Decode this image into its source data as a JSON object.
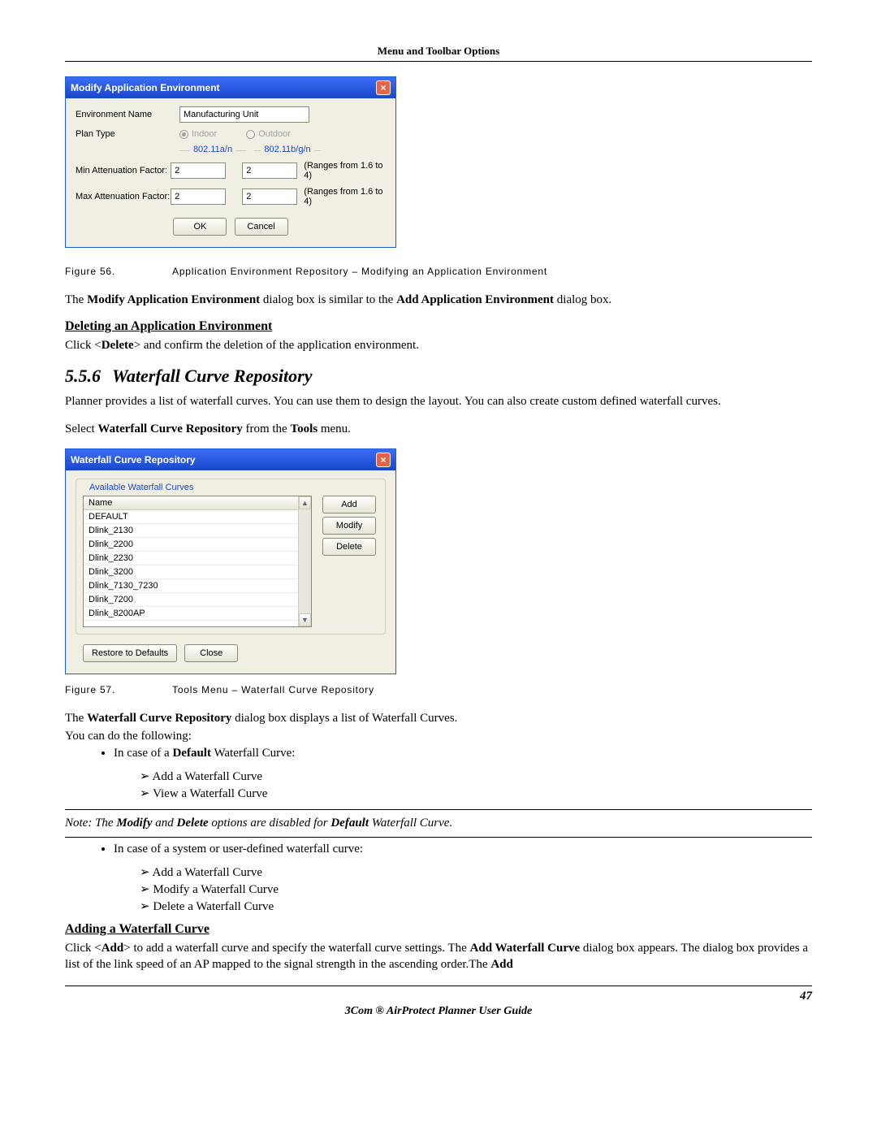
{
  "header": {
    "title": "Menu and Toolbar Options"
  },
  "dialog1": {
    "title": "Modify Application Environment",
    "labels": {
      "env_name": "Environment Name",
      "plan_type": "Plan Type",
      "min_atten": "Min Attenuation Factor:",
      "max_atten": "Max Attenuation Factor:"
    },
    "env_name_value": "Manufacturing Unit",
    "radio_indoor": "Indoor",
    "radio_outdoor": "Outdoor",
    "band1": "802.11a/n",
    "band2": "802.11b/g/n",
    "min_a": "2",
    "min_b": "2",
    "max_a": "2",
    "max_b": "2",
    "range_text": "(Ranges from 1.6 to 4)",
    "ok": "OK",
    "cancel": "Cancel"
  },
  "fig56": {
    "num": "Figure 56.",
    "caption": "Application Environment Repository – Modifying an Application Environment"
  },
  "para_modify": {
    "pre": "The ",
    "b1": "Modify Application Environment",
    "mid": " dialog box is similar to the ",
    "b2": "Add Application Environment",
    "post": " dialog box."
  },
  "subhead_delete": "Deleting an Application Environment",
  "para_delete": {
    "pre": "Click <",
    "b": "Delete",
    "post": "> and confirm the deletion of the application environment."
  },
  "section": {
    "num": "5.5.6",
    "title": "Waterfall Curve Repository"
  },
  "para_planner": "Planner provides a list of waterfall curves. You can use them to design the layout. You can also create custom defined waterfall curves.",
  "para_select": {
    "pre": "Select ",
    "b1": "Waterfall Curve Repository",
    "mid": " from the ",
    "b2": "Tools",
    "post": " menu."
  },
  "dialog2": {
    "title": "Waterfall Curve Repository",
    "legend": "Available Waterfall Curves",
    "col_name": "Name",
    "rows": [
      "DEFAULT",
      "Dlink_2130",
      "Dlink_2200",
      "Dlink_2230",
      "Dlink_3200",
      "Dlink_7130_7230",
      "Dlink_7200",
      "Dlink_8200AP"
    ],
    "btn_add": "Add",
    "btn_modify": "Modify",
    "btn_delete": "Delete",
    "btn_restore": "Restore to Defaults",
    "btn_close": "Close"
  },
  "fig57": {
    "num": "Figure 57.",
    "caption": "Tools Menu – Waterfall Curve Repository"
  },
  "para_wcr": {
    "pre": "The ",
    "b": "Waterfall Curve Repository",
    "post": " dialog box displays a list of Waterfall Curves."
  },
  "para_youcan": "You can do the following:",
  "bul_default": {
    "pre": "In case of a ",
    "b": "Default",
    "post": " Waterfall Curve:"
  },
  "arrows1": [
    "Add a Waterfall Curve",
    "View a Waterfall Curve"
  ],
  "note": {
    "pre": "Note: The ",
    "b1": "Modify",
    "mid1": " and ",
    "b2": "Delete",
    "mid2": " options are disabled for ",
    "b3": "Default",
    "post": " Waterfall Curve."
  },
  "bul_system": "In case of a system or user-defined waterfall curve:",
  "arrows2": [
    "Add a Waterfall Curve",
    "Modify a Waterfall Curve",
    "Delete a Waterfall Curve"
  ],
  "subhead_add": "Adding a Waterfall Curve",
  "para_add": {
    "pre": "Click <",
    "b1": "Add",
    "mid1": "> to add a waterfall curve and specify the waterfall curve settings. The ",
    "b2": "Add Waterfall Curve",
    "mid2": " dialog box appears. The dialog box provides a list of the link speed of an AP mapped to the signal strength in the ascending order.The ",
    "b3": "Add"
  },
  "page_number": "47",
  "footer": "3Com ® AirProtect Planner User Guide"
}
